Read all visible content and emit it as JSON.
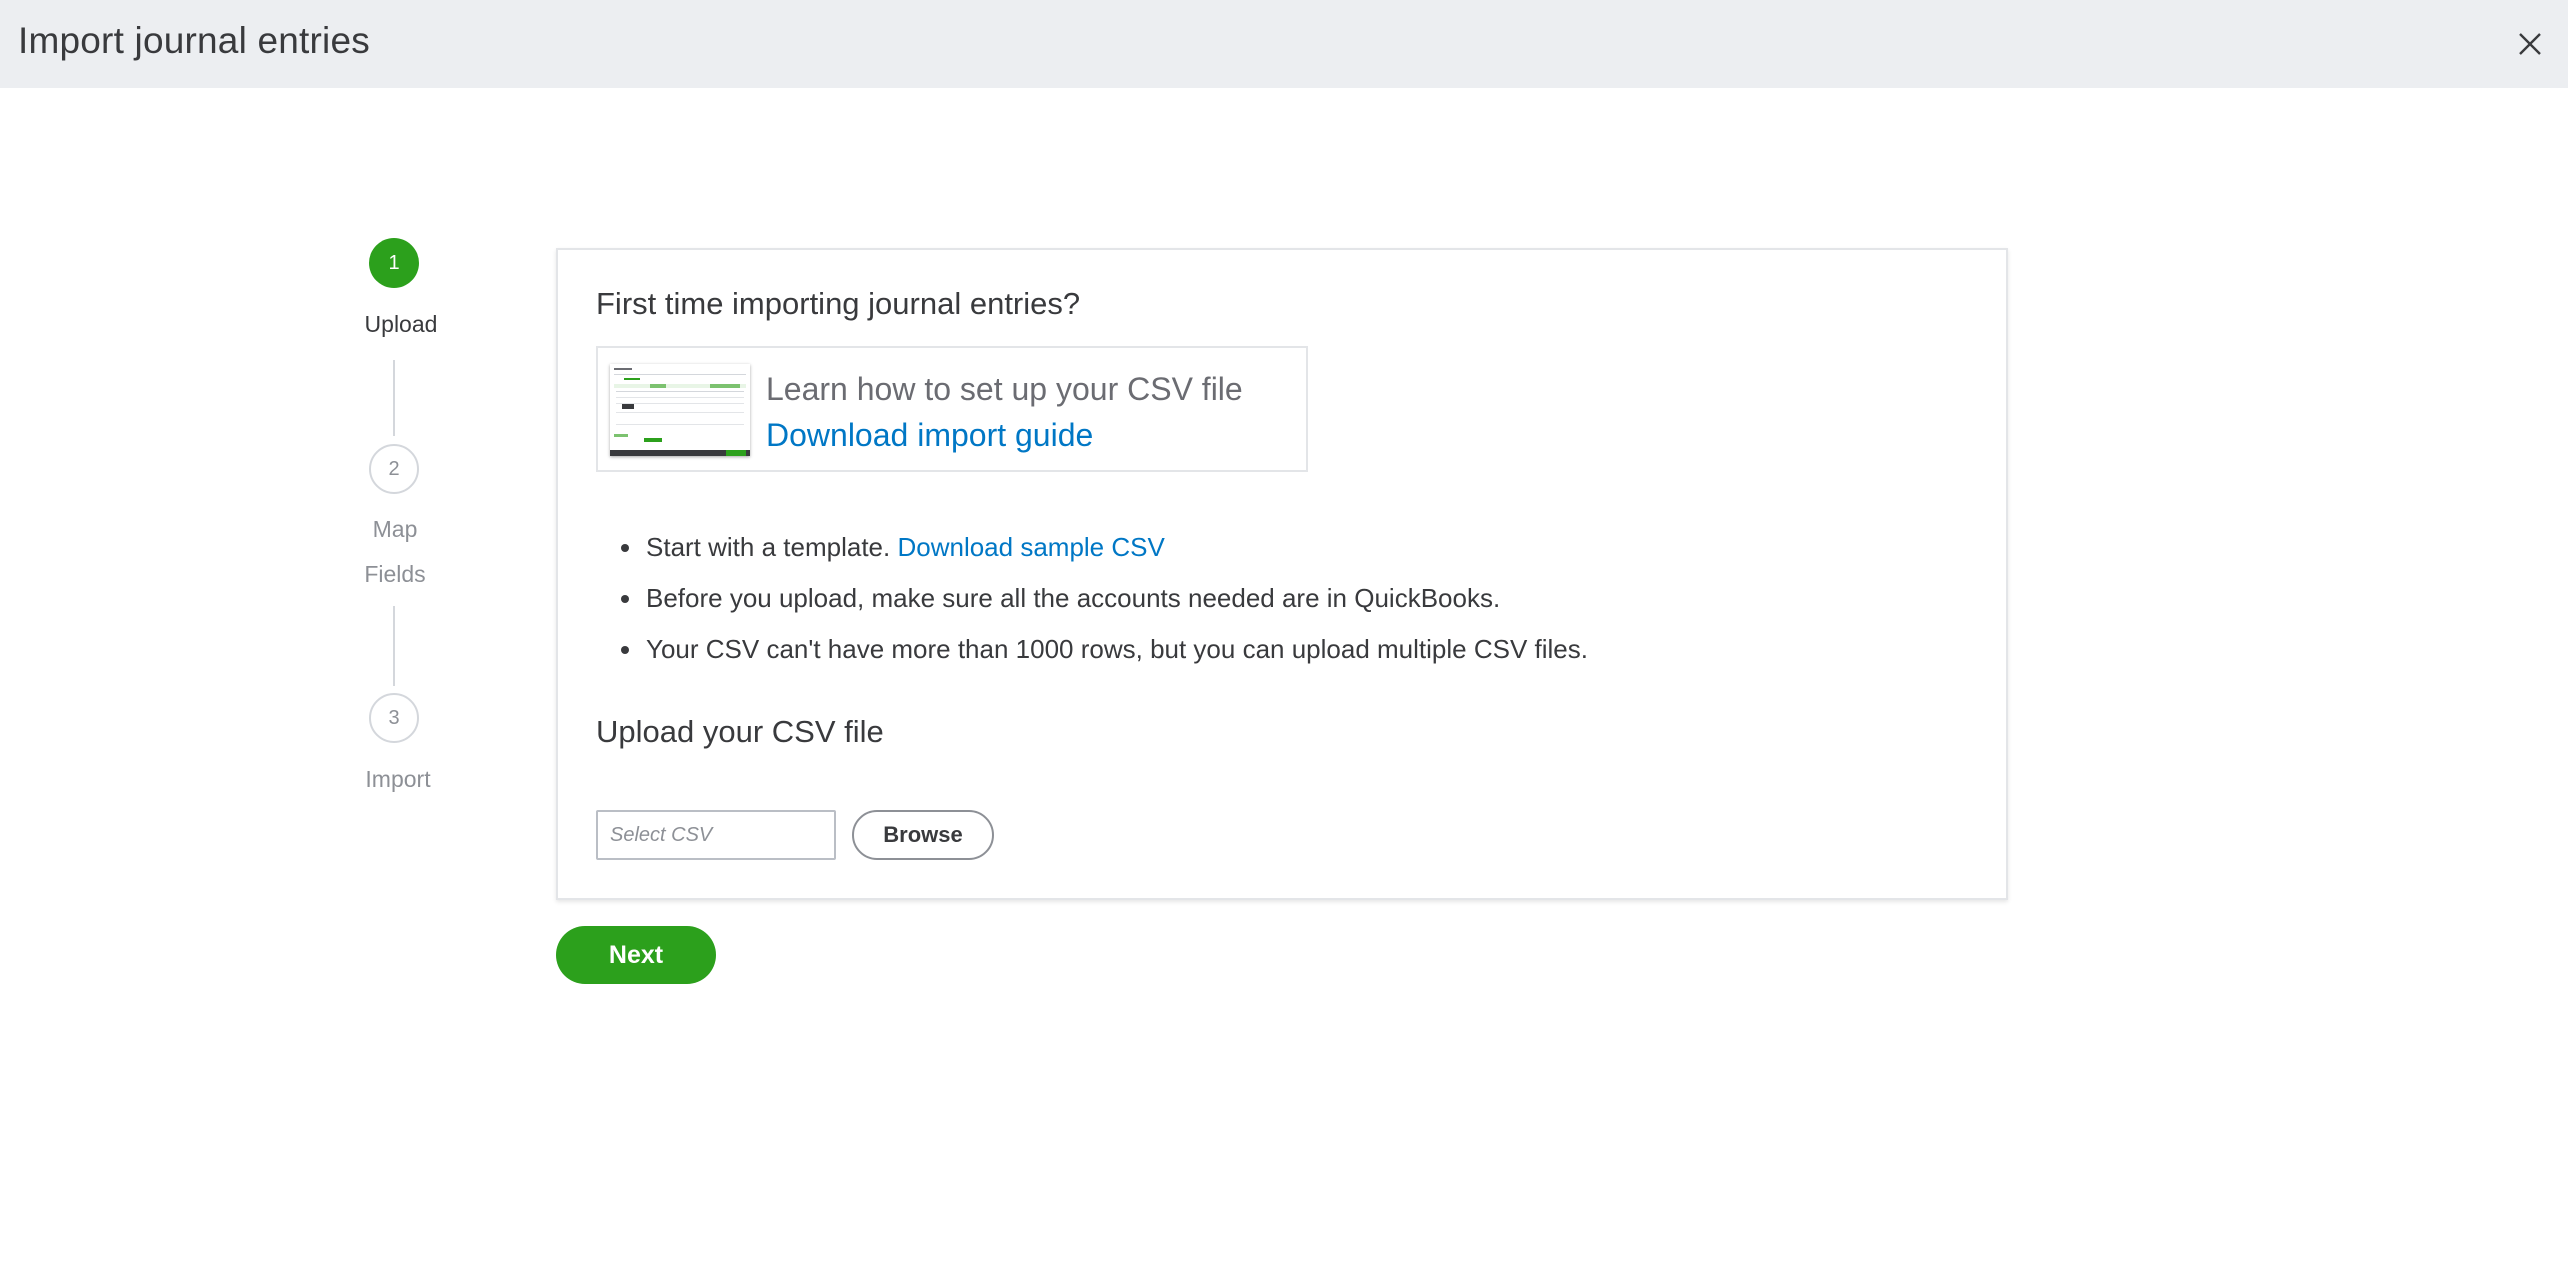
{
  "header": {
    "title": "Import journal entries",
    "close_icon": "close-icon"
  },
  "stepper": {
    "steps": [
      {
        "number": "1",
        "label": "Upload",
        "state": "active"
      },
      {
        "number": "2",
        "label_line1": "Map",
        "label_line2": "Fields",
        "state": "inactive"
      },
      {
        "number": "3",
        "label": "Import",
        "state": "inactive"
      }
    ]
  },
  "card": {
    "heading": "First time importing journal entries?",
    "guide": {
      "text": "Learn how to set up your CSV file",
      "link": "Download import guide"
    },
    "tips": {
      "item1_text": "Start with a template.",
      "item1_link": "Download sample CSV",
      "item2_text": "Before you upload, make sure all the accounts needed are in QuickBooks.",
      "item3_text": "Your CSV can't have more than 1000 rows, but you can upload multiple CSV files."
    },
    "upload_heading": "Upload your CSV file",
    "csv_input": {
      "placeholder": "Select CSV",
      "value": ""
    },
    "browse_label": "Browse"
  },
  "actions": {
    "next_label": "Next"
  },
  "colors": {
    "brand_green": "#2ca01c",
    "link_blue": "#0077c5",
    "header_bg": "#eceef1",
    "text": "#393a3d"
  }
}
